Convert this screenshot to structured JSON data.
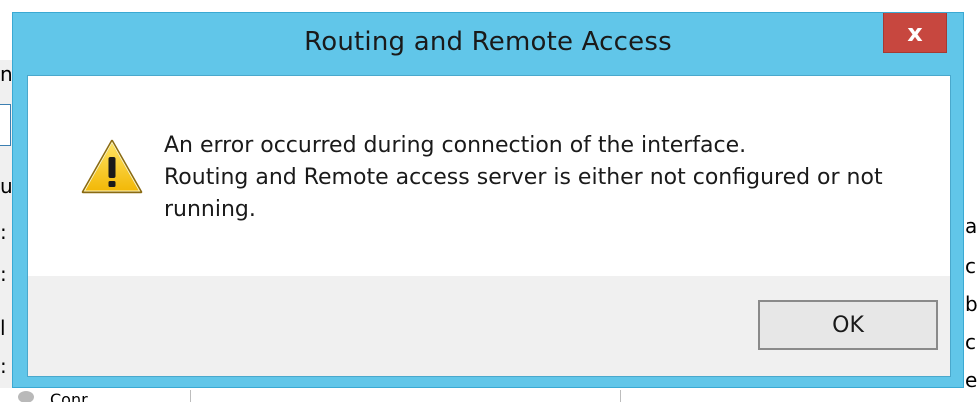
{
  "dialog": {
    "title": "Routing and Remote Access",
    "close_label": "x",
    "message_lines": [
      "An error occurred during connection of the interface.",
      "Routing and Remote access server is either not configured or not",
      "running."
    ],
    "ok_label": "OK",
    "icon": "warning-icon",
    "colors": {
      "titlebar": "#61c6e9",
      "close_button": "#c7473f",
      "button_area": "#f0f0f0"
    }
  },
  "background": {
    "left_fragments": [
      "n",
      "u",
      ":",
      ":",
      "l",
      ":"
    ],
    "right_fragments": [
      "a",
      "c",
      "b",
      "c",
      "e"
    ],
    "bottom_text": "Conr..."
  }
}
